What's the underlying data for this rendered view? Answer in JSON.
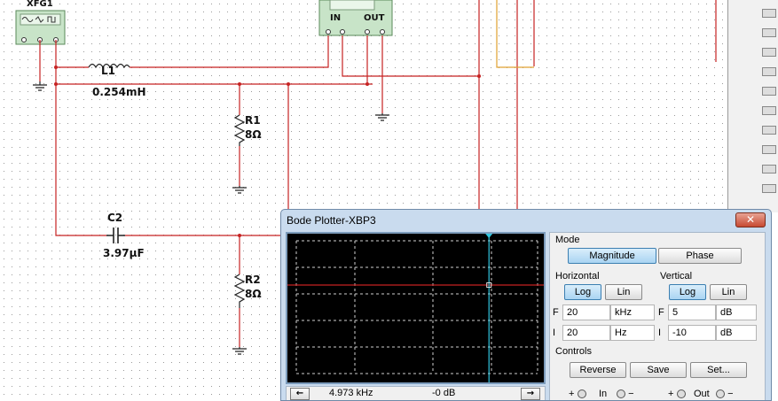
{
  "schematic": {
    "function_generator": {
      "name": "XFG1"
    },
    "bode_block": {
      "in_label": "IN",
      "out_label": "OUT",
      "signs": [
        "+",
        "−",
        "+",
        "−"
      ]
    },
    "L1": {
      "name": "L1",
      "value": "0.254mH"
    },
    "R1": {
      "name": "R1",
      "value": "8Ω"
    },
    "C2": {
      "name": "C2",
      "value": "3.97µF"
    },
    "R2": {
      "name": "R2",
      "value": "8Ω"
    }
  },
  "bode": {
    "title": "Bode Plotter-XBP3",
    "close_label": "✕",
    "mode": {
      "label": "Mode",
      "magnitude": "Magnitude",
      "phase": "Phase",
      "active": "magnitude"
    },
    "horizontal": {
      "label": "Horizontal",
      "log": "Log",
      "lin": "Lin",
      "active": "log",
      "F": {
        "label": "F",
        "value": "20",
        "unit": "kHz"
      },
      "I": {
        "label": "I",
        "value": "20",
        "unit": "Hz"
      }
    },
    "vertical": {
      "label": "Vertical",
      "log": "Log",
      "lin": "Lin",
      "active": "log",
      "F": {
        "label": "F",
        "value": "5",
        "unit": "dB"
      },
      "I": {
        "label": "I",
        "value": "-10",
        "unit": "dB"
      }
    },
    "controls": {
      "label": "Controls",
      "reverse": "Reverse",
      "save": "Save",
      "set": "Set..."
    },
    "readout": {
      "left_arrow": "←",
      "right_arrow": "→",
      "frequency": "4.973 kHz",
      "gain": "-0 dB"
    },
    "terminals": {
      "plus": "+",
      "minus": "−",
      "in": "In",
      "out": "Out"
    },
    "plot": {
      "cursor_color": "#33c7e0",
      "trace_color": "#c62222",
      "grid_color": "#cfcfcf"
    }
  }
}
